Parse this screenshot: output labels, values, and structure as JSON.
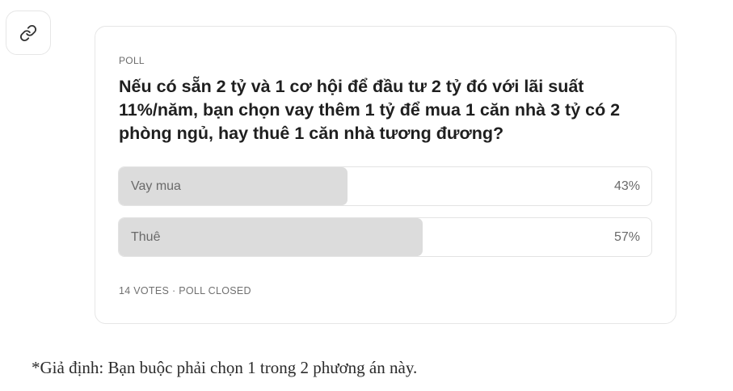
{
  "link_button": {
    "icon": "link-icon"
  },
  "poll": {
    "label": "POLL",
    "question": "Nếu có sẵn 2 tỷ và 1 cơ hội để đầu tư 2 tỷ đó với lãi suất 11%/năm, bạn chọn vay thêm 1 tỷ để mua 1 căn nhà 3 tỷ có 2 phòng ngủ, hay thuê 1 căn nhà tương đương?",
    "options": [
      {
        "label": "Vay mua",
        "percent_text": "43%",
        "share": 0.43
      },
      {
        "label": "Thuê",
        "percent_text": "57%",
        "share": 0.57
      }
    ],
    "votes": "14 VOTES",
    "separator": "·",
    "status": "POLL CLOSED"
  },
  "footnote": "*Giả định: Bạn buộc phải chọn 1 trong 2 phương án này.",
  "colors": {
    "bar_fill": "#dcdcdc",
    "border": "#e6e6e6",
    "muted_text": "#6a6a6a"
  }
}
